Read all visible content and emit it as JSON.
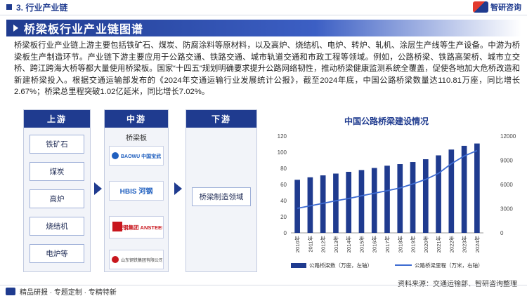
{
  "header": {
    "section": "3. 行业产业链",
    "brand": "智研咨询"
  },
  "title": "桥梁板行业产业链图谱",
  "paragraph": "桥梁板行业产业链上游主要包括铁矿石、煤炭、防腐涂料等原材料，以及高炉、烧结机、电炉、转炉、轧机、涂层生产线等生产设备。中游为桥梁板生产制造环节。产业链下游主要应用于公路交通、铁路交通、城市轨道交通和市政工程等领域。例如，公路桥梁、铁路高架桥、城市立交桥、跨江跨海大桥等都大量使用桥梁板。国家“十四五”规划明确要求提升公路网络韧性，推动桥梁健康监测系统全覆盖，促使各地加大危桥改造和新建桥梁投入。根据交通运输部发布的《2024年交通运输行业发展统计公报》，截至2024年底，中国公路桥梁数量达110.81万座，同比增长2.67%；桥梁总里程突破1.02亿延米，同比增长7.02%。",
  "chain": {
    "upstream": {
      "label": "上游",
      "items": [
        "铁矿石",
        "煤炭",
        "高炉",
        "烧结机",
        "电炉等"
      ]
    },
    "midstream": {
      "label": "中游",
      "product": "桥梁板",
      "logos": [
        {
          "icon": "baowu-logo",
          "text": "BAOWU 中国宝武"
        },
        {
          "icon": "hbis-logo",
          "text": "HBIS 河钢"
        },
        {
          "icon": "ansteel-logo",
          "text": "鞍钢集团 ANSTEEL"
        },
        {
          "icon": "shandong-steel-logo",
          "text": "山东钢铁集团有限公司"
        }
      ]
    },
    "downstream": {
      "label": "下游",
      "items": [
        "桥梁制造领域"
      ]
    }
  },
  "chart_data": {
    "type": "bar",
    "title": "中国公路桥梁建设情况",
    "categories": [
      "2010年",
      "2011年",
      "2012年",
      "2013年",
      "2014年",
      "2015年",
      "2016年",
      "2017年",
      "2018年",
      "2019年",
      "2020年",
      "2021年",
      "2022年",
      "2023年",
      "2024年"
    ],
    "series": [
      {
        "name": "公路桥梁数（万座，左轴）",
        "type": "bar",
        "axis": "left",
        "color": "#1f3b8f",
        "values": [
          65.8,
          68.9,
          71.3,
          73.5,
          75.7,
          77.9,
          80.5,
          83.3,
          85.2,
          87.8,
          91.3,
          96.1,
          103.3,
          107.9,
          110.8
        ]
      },
      {
        "name": "公路桥梁里程（万米，右轴）",
        "type": "line",
        "axis": "right",
        "color": "#3d6bd1",
        "values": [
          3048,
          3349,
          3662,
          3978,
          4257,
          4593,
          4917,
          5226,
          5569,
          6063,
          6628,
          7380,
          8576,
          9529,
          10200
        ]
      }
    ],
    "left_axis": {
      "ticks": [
        "0",
        "20",
        "40",
        "60",
        "80",
        "100",
        "120"
      ],
      "ylim": [
        0,
        120
      ]
    },
    "right_axis": {
      "ticks": [
        "0",
        "3000",
        "6000",
        "9000",
        "12000"
      ],
      "ylim": [
        0,
        12000
      ]
    },
    "legend": "bottom"
  },
  "source": "资料来源：交通运输部、智研咨询整理",
  "footer": "精品研报 · 专题定制 · 专精特新"
}
